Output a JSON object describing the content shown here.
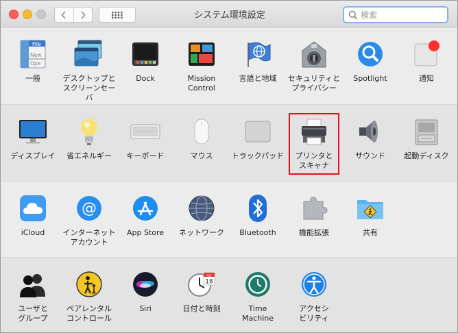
{
  "window": {
    "title": "システム環境設定",
    "search_placeholder": "検索"
  },
  "highlight_color": "#e0121a",
  "sections": [
    {
      "items": [
        {
          "label": "一般",
          "icon": "general-icon"
        },
        {
          "label": "デスクトップと\nスクリーンセーバ",
          "icon": "desktop-screensaver-icon"
        },
        {
          "label": "Dock",
          "icon": "dock-icon"
        },
        {
          "label": "Mission\nControl",
          "icon": "mission-control-icon"
        },
        {
          "label": "言語と地域",
          "icon": "language-region-icon"
        },
        {
          "label": "セキュリティと\nプライバシー",
          "icon": "security-privacy-icon"
        },
        {
          "label": "Spotlight",
          "icon": "spotlight-icon"
        },
        {
          "label": "通知",
          "icon": "notifications-icon"
        }
      ]
    },
    {
      "items": [
        {
          "label": "ディスプレイ",
          "icon": "display-icon"
        },
        {
          "label": "省エネルギー",
          "icon": "energy-saver-icon"
        },
        {
          "label": "キーボード",
          "icon": "keyboard-icon"
        },
        {
          "label": "マウス",
          "icon": "mouse-icon"
        },
        {
          "label": "トラックパッド",
          "icon": "trackpad-icon"
        },
        {
          "label": "プリンタと\nスキャナ",
          "icon": "printer-scanner-icon"
        },
        {
          "label": "サウンド",
          "icon": "sound-icon"
        },
        {
          "label": "起動ディスク",
          "icon": "startup-disk-icon"
        }
      ]
    },
    {
      "items": [
        {
          "label": "iCloud",
          "icon": "icloud-icon"
        },
        {
          "label": "インターネット\nアカウント",
          "icon": "internet-accounts-icon"
        },
        {
          "label": "App Store",
          "icon": "app-store-icon"
        },
        {
          "label": "ネットワーク",
          "icon": "network-icon"
        },
        {
          "label": "Bluetooth",
          "icon": "bluetooth-icon"
        },
        {
          "label": "機能拡張",
          "icon": "extensions-icon"
        },
        {
          "label": "共有",
          "icon": "sharing-icon"
        }
      ]
    },
    {
      "items": [
        {
          "label": "ユーザと\nグループ",
          "icon": "users-groups-icon"
        },
        {
          "label": "ペアレンタル\nコントロール",
          "icon": "parental-controls-icon"
        },
        {
          "label": "Siri",
          "icon": "siri-icon"
        },
        {
          "label": "日付と時刻",
          "icon": "date-time-icon"
        },
        {
          "label": "Time\nMachine",
          "icon": "time-machine-icon"
        },
        {
          "label": "アクセシ\nビリティ",
          "icon": "accessibility-icon"
        }
      ]
    }
  ],
  "calendar_icon": {
    "month": "JUL",
    "day": "18"
  },
  "general_icon_text": {
    "line1": "File",
    "line2": "New",
    "line3": "Ope"
  }
}
